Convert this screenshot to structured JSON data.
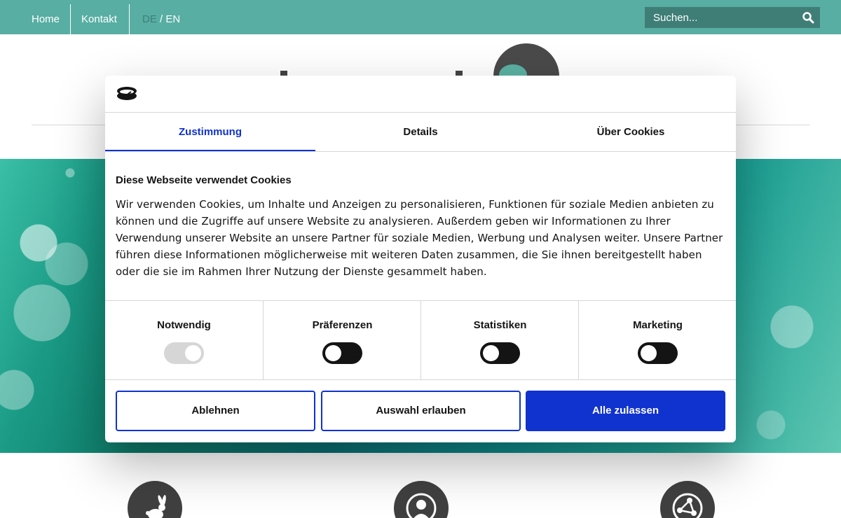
{
  "nav": {
    "home": "Home",
    "kontakt": "Kontakt",
    "lang_de": "DE",
    "lang_sep": " / ",
    "lang_en": "EN"
  },
  "search": {
    "placeholder": "Suchen...",
    "icon": "search-icon"
  },
  "modal": {
    "tabs": [
      {
        "label": "Zustimmung",
        "active": true
      },
      {
        "label": "Details",
        "active": false
      },
      {
        "label": "Über Cookies",
        "active": false
      }
    ],
    "title": "Diese Webseite verwendet Cookies",
    "body": "Wir verwenden Cookies, um Inhalte und Anzeigen zu personalisieren, Funktionen für soziale Medien anbieten zu können und die Zugriffe auf unsere Website zu analysieren. Außerdem geben wir Informationen zu Ihrer Verwendung unserer Website an unsere Partner für soziale Medien, Werbung und Analysen weiter. Unsere Partner führen diese Informationen möglicherweise mit weiteren Daten zusammen, die Sie ihnen bereitgestellt haben oder die sie im Rahmen Ihrer Nutzung der Dienste gesammelt haben.",
    "toggles": [
      {
        "label": "Notwendig",
        "state": "on",
        "disabled": true
      },
      {
        "label": "Präferenzen",
        "state": "off",
        "disabled": false
      },
      {
        "label": "Statistiken",
        "state": "off",
        "disabled": false
      },
      {
        "label": "Marketing",
        "state": "off",
        "disabled": false
      }
    ],
    "buttons": {
      "reject": "Ablehnen",
      "allow_selection": "Auswahl erlauben",
      "allow_all": "Alle zulassen"
    }
  },
  "colors": {
    "topbar": "#58aea3",
    "search_bg": "#3f7e76",
    "accent_blue": "#1032cf",
    "icon_circle": "#404040"
  },
  "feature_icons": [
    "rabbit-icon",
    "user-icon",
    "network-icon"
  ]
}
